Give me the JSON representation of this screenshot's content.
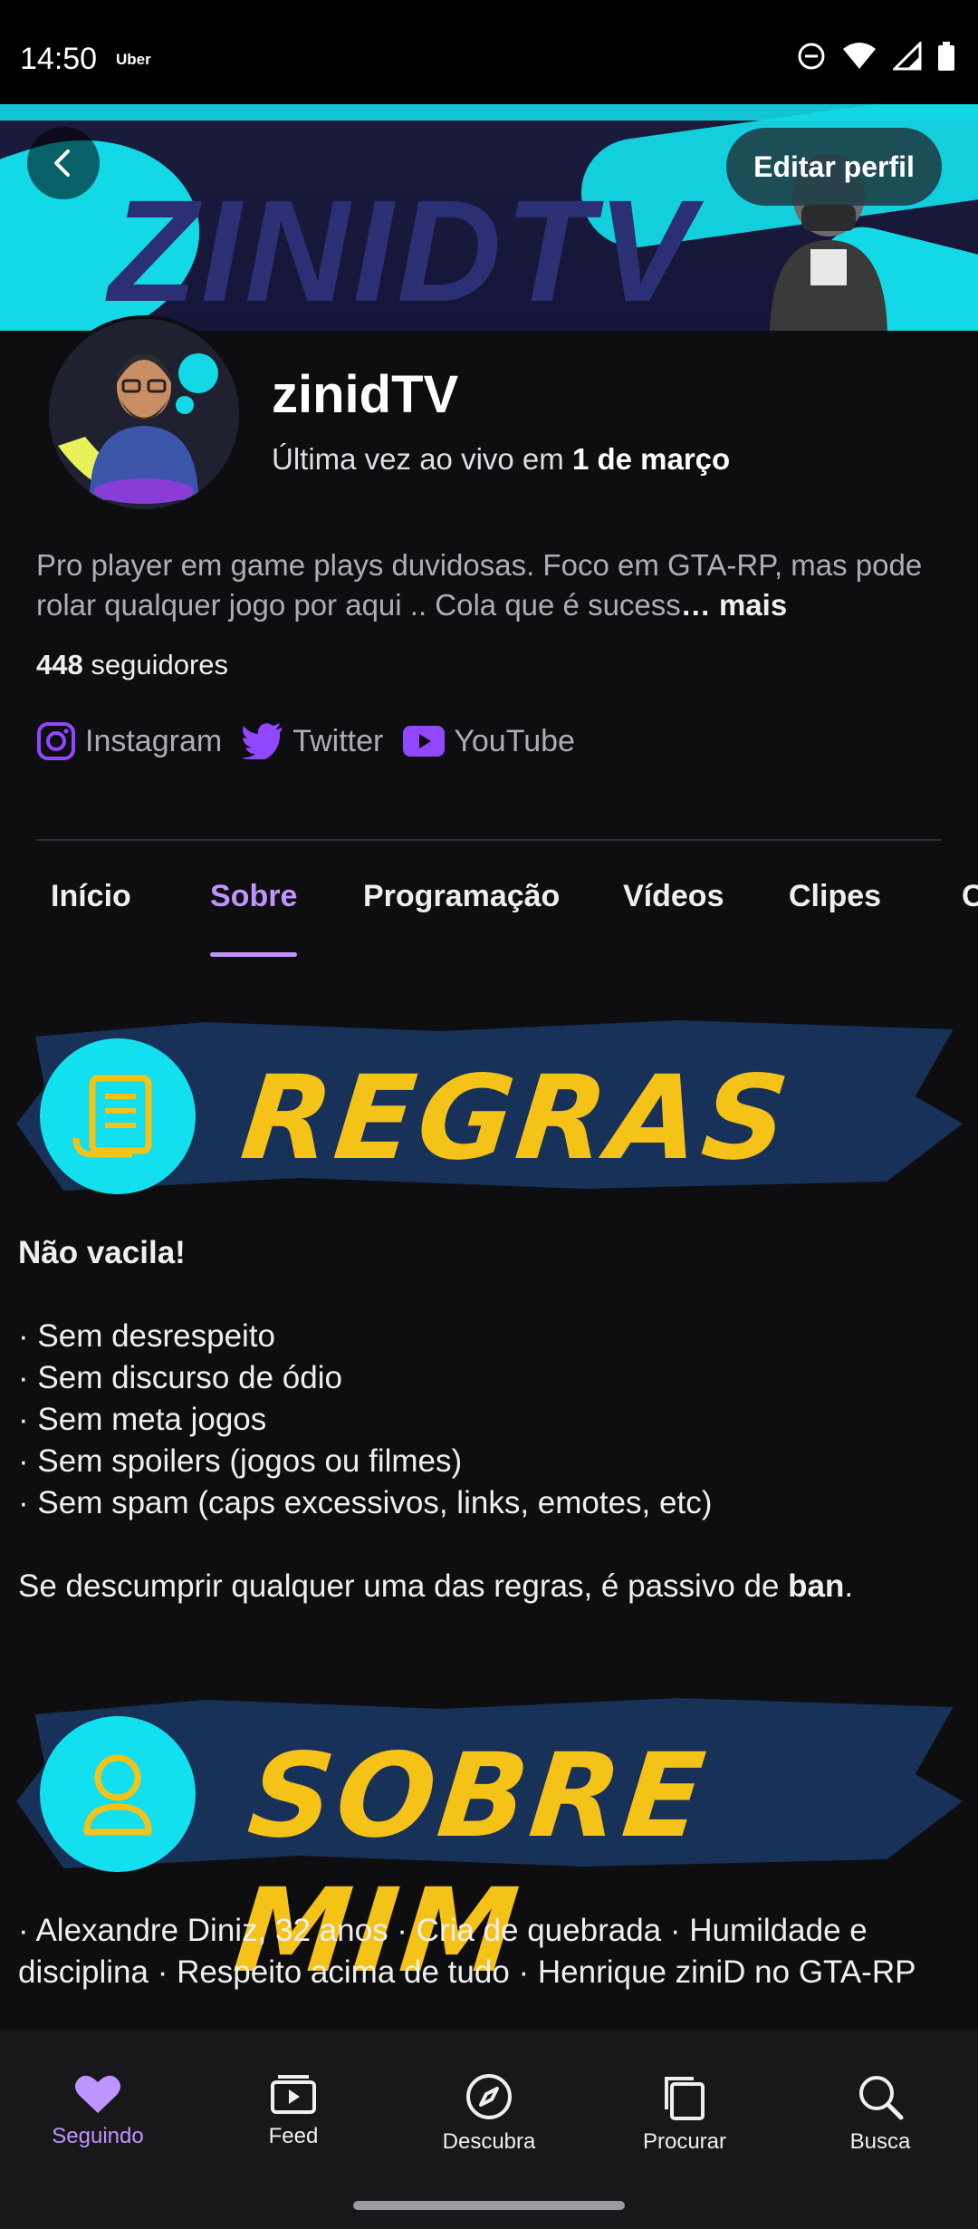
{
  "status_bar": {
    "time": "14:50",
    "app": "Uber"
  },
  "header": {
    "edit_label": "Editar perfil",
    "banner_wordmark": "ZINIDTV"
  },
  "profile": {
    "name": "zinidTV",
    "last_live_prefix": "Última vez ao vivo em ",
    "last_live_date": "1 de março",
    "bio": "Pro player em game plays duvidosas. Foco em GTA-RP, mas pode rolar qualquer jogo por aqui  .. Cola que é sucess",
    "bio_more": "… mais",
    "followers_count": "448",
    "followers_label": " seguidores"
  },
  "socials": [
    {
      "label": "Instagram",
      "icon": "instagram-icon"
    },
    {
      "label": "Twitter",
      "icon": "twitter-icon"
    },
    {
      "label": "YouTube",
      "icon": "youtube-icon"
    }
  ],
  "tabs": [
    "Início",
    "Sobre",
    "Programação",
    "Vídeos",
    "Clipes",
    "C"
  ],
  "active_tab": "Sobre",
  "panels": {
    "rules_title": "REGRAS",
    "about_title": "SOBRE MIM"
  },
  "rules": {
    "heading": "Não vacila!",
    "items": [
      "· Sem desrespeito",
      "· Sem discurso de ódio",
      "· Sem meta jogos",
      "· Sem spoilers (jogos ou filmes)",
      "· Sem spam (caps excessivos, links, emotes, etc)"
    ],
    "footer_prefix": "Se descumprir qualquer uma das regras, é passivo de ",
    "footer_bold": "ban",
    "footer_suffix": "."
  },
  "about": {
    "text": "· Alexandre Diniz, 32 anos · Cria de quebrada · Humildade e disciplina · Respeito acima de tudo · Henrique ziniD no GTA-RP"
  },
  "bottom_nav": [
    {
      "label": "Seguindo",
      "icon": "heart-icon"
    },
    {
      "label": "Feed",
      "icon": "feed-icon"
    },
    {
      "label": "Descubra",
      "icon": "compass-icon"
    },
    {
      "label": "Procurar",
      "icon": "browse-icon"
    },
    {
      "label": "Busca",
      "icon": "search-icon"
    }
  ],
  "colors": {
    "accent": "#bf94ff",
    "background": "#0e0e10",
    "panel_yellow": "#f5c218",
    "panel_cyan": "#12e0ef"
  }
}
